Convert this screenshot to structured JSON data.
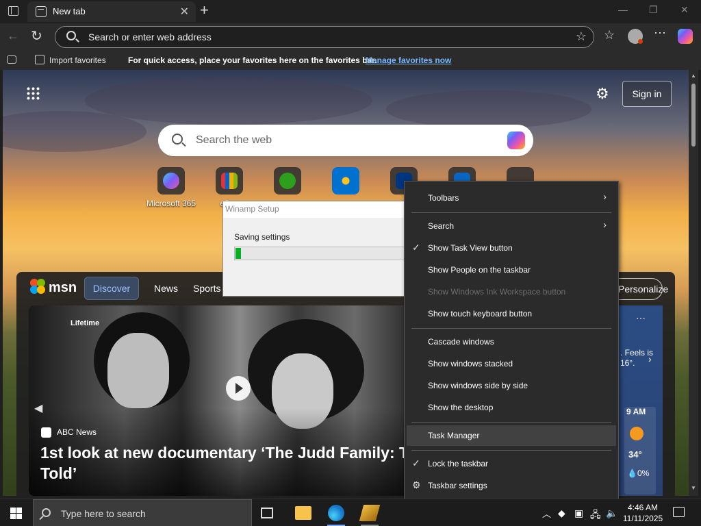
{
  "browser": {
    "tab_title": "New tab",
    "address_placeholder": "Search or enter web address",
    "favbar": {
      "import_label": "Import favorites",
      "message": "For quick access, place your favorites here on the favorites bar.",
      "link": "Manage favorites now"
    }
  },
  "newtab": {
    "signin": "Sign in",
    "search_placeholder": "Search the web",
    "tiles": [
      {
        "label": "Microsoft 365",
        "color": "#5b5fc7"
      },
      {
        "label": "eBay",
        "color": "#e53238"
      },
      {
        "label": "",
        "color": "#2ca01c"
      },
      {
        "label": "",
        "color": "#0071ce"
      },
      {
        "label": "",
        "color": "#003580"
      },
      {
        "label": "",
        "color": "#0a66c2"
      },
      {
        "label": "",
        "color": "#555555"
      }
    ]
  },
  "feed": {
    "brand": "msn",
    "tabs": [
      "Discover",
      "News",
      "Sports"
    ],
    "personalize": "Personalize",
    "hero": {
      "channel": "Lifetime",
      "source": "ABC News",
      "headline": "1st look at new documentary ‘The Judd Family: Truth Be Told’"
    },
    "weather": {
      "feels": ". Feels is 16°.",
      "hour": "9 AM",
      "temp": "34°",
      "precip": "0%"
    }
  },
  "winamp": {
    "title": "Winamp Setup",
    "status": "Saving settings",
    "progress": 0.03
  },
  "context_menu": {
    "items": [
      {
        "label": "Toolbars",
        "submenu": true
      },
      {
        "label": "Search",
        "submenu": true
      },
      {
        "label": "Show Task View button",
        "checked": true
      },
      {
        "label": "Show People on the taskbar"
      },
      {
        "label": "Show Windows Ink Workspace button",
        "disabled": true
      },
      {
        "label": "Show touch keyboard button"
      },
      {
        "label": "Cascade windows"
      },
      {
        "label": "Show windows stacked"
      },
      {
        "label": "Show windows side by side"
      },
      {
        "label": "Show the desktop"
      },
      {
        "label": "Task Manager",
        "highlighted": true
      },
      {
        "label": "Lock the taskbar",
        "checked": true
      },
      {
        "label": "Taskbar settings",
        "icon": "gear-icon"
      }
    ]
  },
  "taskbar": {
    "search_placeholder": "Type here to search",
    "time": "4:46 AM",
    "date": "11/11/2025"
  }
}
